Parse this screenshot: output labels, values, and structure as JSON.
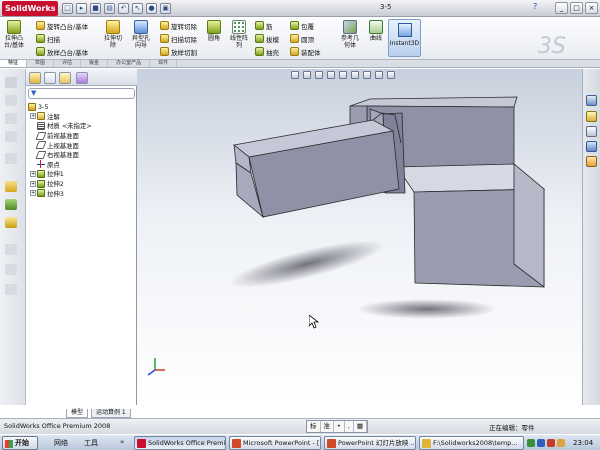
{
  "app": {
    "logo": "SolidWorks",
    "doc_title": "3-5"
  },
  "window_buttons": [
    "_",
    "□",
    "×"
  ],
  "help": "?",
  "quick_access": [
    "new",
    "open",
    "save",
    "print",
    "undo",
    "rebuild",
    "options"
  ],
  "ribbon": {
    "large": [
      {
        "label": "拉伸凸\n台/基体",
        "icon": "boss-extrude-icon"
      },
      {
        "label": "拉伸切\n除",
        "icon": "cut-extrude-icon"
      },
      {
        "label": "异型孔\n向导",
        "icon": "hole-wizard-icon"
      },
      {
        "label": "圆角",
        "icon": "fillet-icon"
      },
      {
        "label": "线性阵\n列",
        "icon": "linear-pattern-icon"
      },
      {
        "label": "参考几\n何体",
        "icon": "reference-geometry-icon"
      },
      {
        "label": "曲线",
        "icon": "curves-icon"
      }
    ],
    "small_col1": [
      "旋转凸台/基体",
      "扫描",
      "放样凸台/基体"
    ],
    "small_col2": [
      "旋转切除",
      "扫描切除",
      "放样切割"
    ],
    "small_col3": [
      "筋",
      "拔模",
      "抽壳"
    ],
    "small_col4": [
      "包覆",
      "圆顶",
      "装配体"
    ],
    "instant3d": "Instant3D"
  },
  "ribbon_tabs": [
    "特征",
    "草图",
    "评估",
    "钣金",
    "办公室产品",
    "焊件"
  ],
  "feature_tree": [
    {
      "label": "3-5",
      "expand": "",
      "icon": "part-icon"
    },
    {
      "label": "注解",
      "expand": "+",
      "icon": "annotations-icon"
    },
    {
      "label": "材质 <未指定>",
      "expand": "",
      "icon": "material-icon"
    },
    {
      "label": "前视基准面",
      "expand": "",
      "icon": "plane-icon"
    },
    {
      "label": "上视基准面",
      "expand": "",
      "icon": "plane-icon"
    },
    {
      "label": "右视基准面",
      "expand": "",
      "icon": "plane-icon"
    },
    {
      "label": "原点",
      "expand": "",
      "icon": "origin-icon"
    },
    {
      "label": "拉伸1",
      "expand": "+",
      "icon": "extrude-icon"
    },
    {
      "label": "拉伸2",
      "expand": "+",
      "icon": "extrude-icon"
    },
    {
      "label": "拉伸3",
      "expand": "+",
      "icon": "extrude-icon"
    }
  ],
  "panel_tabs": [
    "模型",
    "运动算例 1"
  ],
  "status": {
    "left": "SolidWorks Office Premium 2008",
    "ime": [
      "标",
      "准",
      "•",
      ",",
      "▦"
    ],
    "editing": "正在编辑：零件"
  },
  "taskbar": {
    "start": "开始",
    "labels": [
      "网络",
      "工具"
    ],
    "more": "»",
    "buttons": [
      {
        "label": "SolidWorks Office Premi...",
        "color": "#c8102e"
      },
      {
        "label": "Microsoft PowerPoint - [...",
        "color": "#d24726"
      },
      {
        "label": "PowerPoint 幻灯片放映 ...",
        "color": "#d24726"
      },
      {
        "label": "F:\\Solidworks2008\\temp...",
        "color": "#e0b53a"
      }
    ],
    "clock": "23:04"
  }
}
